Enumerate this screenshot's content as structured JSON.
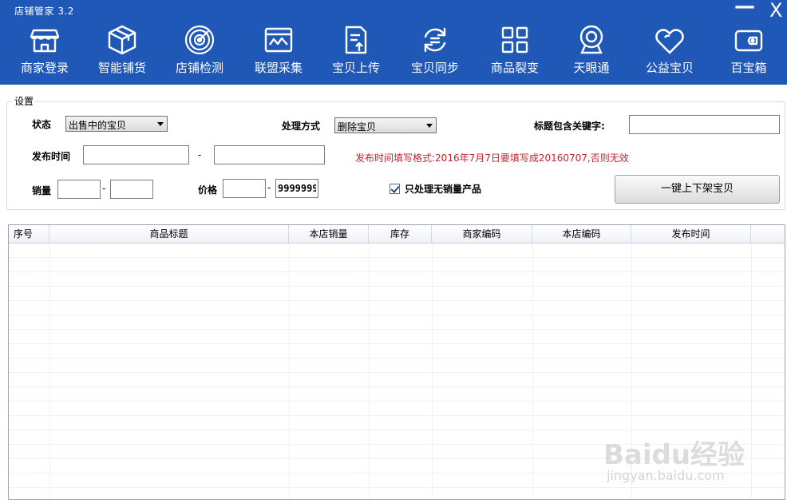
{
  "window": {
    "title": "店铺管家  3.2",
    "minimize_glyph": "—",
    "close_glyph": "X"
  },
  "nav": [
    {
      "label": "商家登录",
      "icon": "store-icon"
    },
    {
      "label": "智能铺货",
      "icon": "box-icon"
    },
    {
      "label": "店铺检测",
      "icon": "radar-icon"
    },
    {
      "label": "联盟采集",
      "icon": "collect-icon"
    },
    {
      "label": "宝贝上传",
      "icon": "upload-icon"
    },
    {
      "label": "宝贝同步",
      "icon": "sync-icon"
    },
    {
      "label": "商品裂变",
      "icon": "grid-icon"
    },
    {
      "label": "天眼通",
      "icon": "camera-icon"
    },
    {
      "label": "公益宝贝",
      "icon": "heart-icon"
    },
    {
      "label": "百宝箱",
      "icon": "wallet-icon"
    }
  ],
  "settings": {
    "legend": "设置",
    "status_label": "状态",
    "status_value": "出售中的宝贝",
    "mode_label": "处理方式",
    "mode_value": "删除宝贝",
    "keyword_label": "标题包含关键字:",
    "keyword_value": "",
    "publish_label": "发布时间",
    "publish_from": "",
    "publish_to": "",
    "dash": "-",
    "hint": "发布时间填写格式:2016年7月7日要填写成20160707,否则无效",
    "sales_label": "销量",
    "sales_from": "",
    "sales_to": "",
    "price_label": "价格",
    "price_from": "",
    "price_to": "9999999",
    "only_no_sales_label": "只处理无销量产品",
    "only_no_sales_checked": true,
    "action_button": "一键上下架宝贝"
  },
  "table": {
    "columns": [
      "序号",
      "商品标题",
      "本店销量",
      "库存",
      "商家编码",
      "本店编码",
      "发布时间"
    ],
    "rows": []
  },
  "watermark": {
    "logo": "Baidu经验",
    "url": "jingyan.baidu.com"
  },
  "colors": {
    "toolbar_bg": "#1f58b6",
    "hint_text": "#c0262d"
  }
}
